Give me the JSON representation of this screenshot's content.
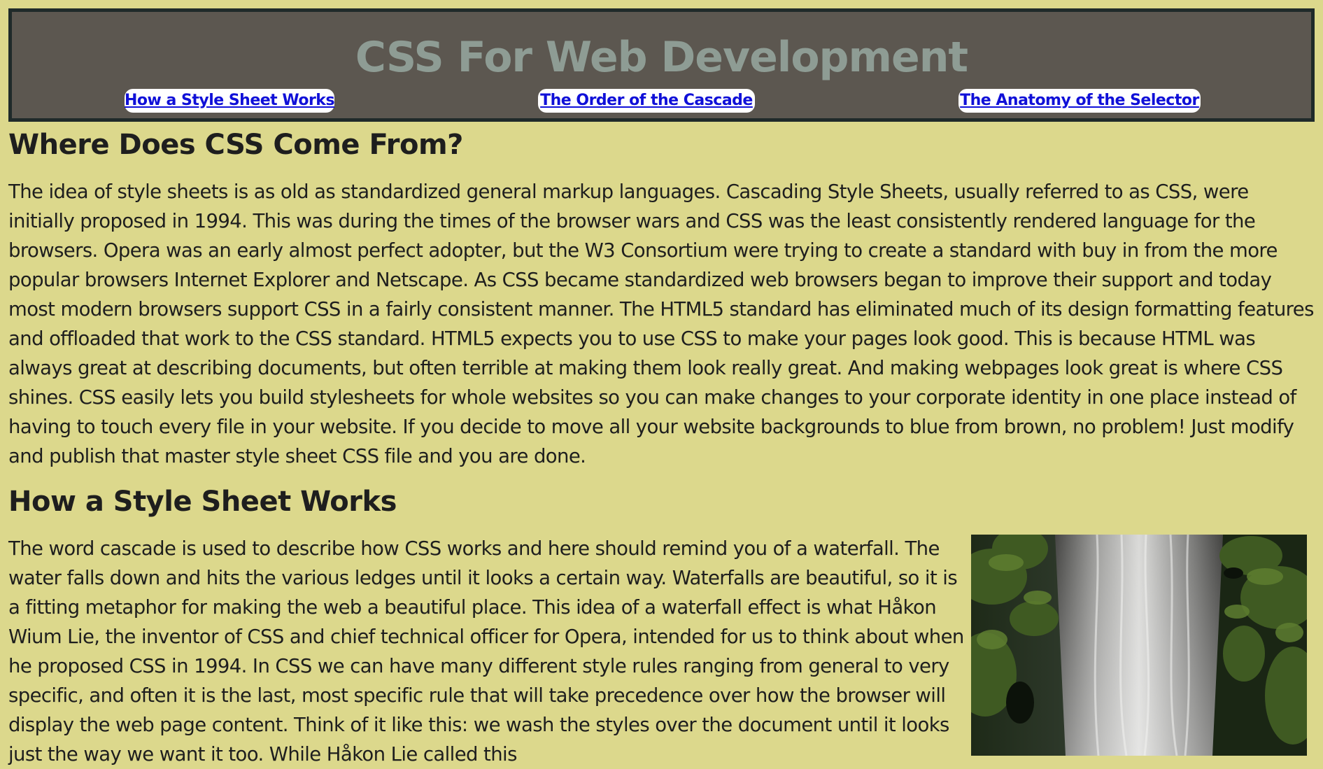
{
  "site": {
    "title": "CSS For Web Development"
  },
  "nav": {
    "links": [
      {
        "label": "How a Style Sheet Works"
      },
      {
        "label": "The Order of the Cascade"
      },
      {
        "label": "The Anatomy of the Selector"
      }
    ]
  },
  "sections": [
    {
      "heading": "Where Does CSS Come From?",
      "body": "The idea of style sheets is as old as standardized general markup languages. Cascading Style Sheets, usually referred to as CSS, were initially proposed in 1994. This was during the times of the browser wars and CSS was the least consistently rendered language for the browsers. Opera was an early almost perfect adopter, but the W3 Consortium were trying to create a standard with buy in from the more popular browsers Internet Explorer and Netscape. As CSS became standardized web browsers began to improve their support and today most modern browsers support CSS in a fairly consistent manner. The HTML5 standard has eliminated much of its design formatting features and offloaded that work to the CSS standard. HTML5 expects you to use CSS to make your pages look good. This is because HTML was always great at describing documents, but often terrible at making them look really great. And making webpages look great is where CSS shines. CSS easily lets you build stylesheets for whole websites so you can make changes to your corporate identity in one place instead of having to touch every file in your website. If you decide to move all your website backgrounds to blue from brown, no problem! Just modify and publish that master style sheet CSS file and you are done."
    },
    {
      "heading": "How a Style Sheet Works",
      "body": "The word cascade is used to describe how CSS works and here should remind you of a waterfall. The water falls down and hits the various ledges until it looks a certain way. Waterfalls are beautiful, so it is a fitting metaphor for making the web a beautiful place. This idea of a waterfall effect is what Håkon Wium Lie, the inventor of CSS and chief technical officer for Opera, intended for us to think about when he proposed CSS in 1994. In CSS we can have many different style rules ranging from general to very specific, and often it is the last, most specific rule that will take precedence over how the browser will display the web page content. Think of it like this: we wash the styles over the document until it looks just the way we want it too. While Håkon Lie called this"
    }
  ],
  "image": {
    "icon": "waterfall-photo"
  }
}
